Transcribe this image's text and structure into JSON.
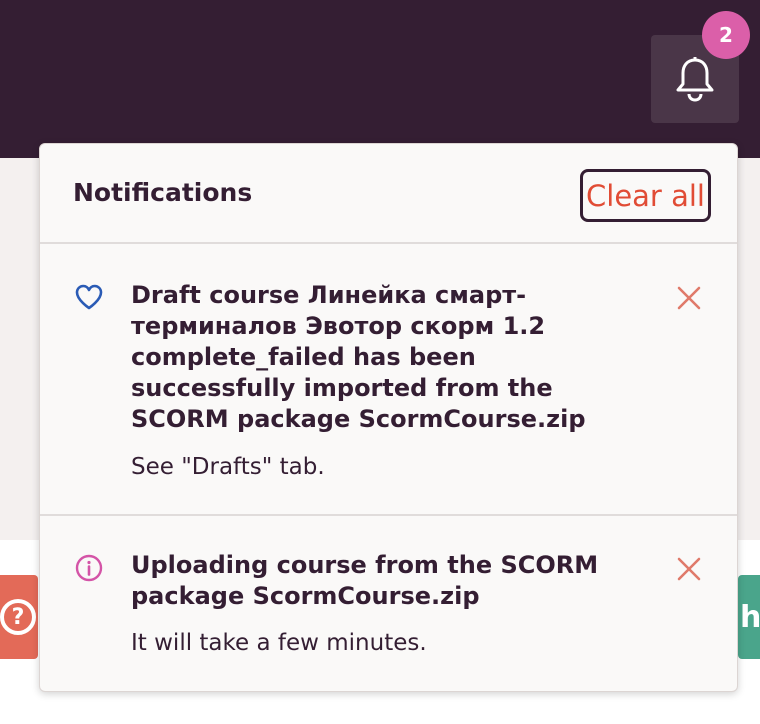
{
  "header": {
    "notification_count": "2"
  },
  "background": {
    "help_symbol": "?",
    "partial_button_text": "h"
  },
  "panel": {
    "title": "Notifications",
    "clear_all_label": "Clear all",
    "items": [
      {
        "icon": "heart-icon",
        "title": "Draft course Линейка смарт-терминалов Эвотор скорм 1.2 complete_failed has been successfully imported from the SCORM package ScormCourse.zip",
        "subtitle": "See \"Drafts\" tab."
      },
      {
        "icon": "info-icon",
        "title": "Uploading course from the SCORM package ScormCourse.zip",
        "subtitle": "It will take a few minutes."
      }
    ]
  },
  "colors": {
    "topbar": "#341e33",
    "badge": "#db5fa9",
    "accent": "#e14c35",
    "heart_icon": "#2a5bb5",
    "info_icon": "#d454a7",
    "close_icon": "#e07a6a"
  }
}
